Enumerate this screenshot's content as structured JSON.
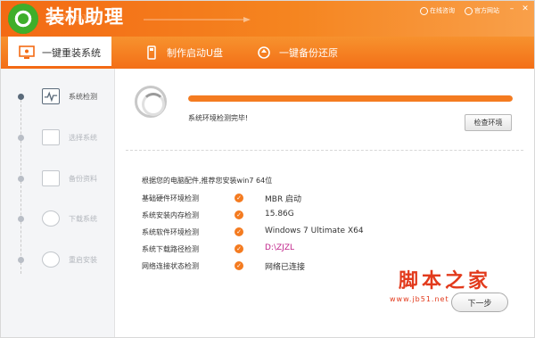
{
  "header": {
    "app_title": "装机助理",
    "online_help": "在线咨询",
    "forum": "官方网站"
  },
  "nav": {
    "tabs": [
      {
        "label": "一键重装系统",
        "icon": "monitor-icon",
        "active": true
      },
      {
        "label": "制作启动U盘",
        "icon": "usb-icon",
        "active": false
      },
      {
        "label": "一键备份还原",
        "icon": "backup-icon",
        "active": false
      }
    ]
  },
  "sidebar": {
    "steps": [
      {
        "label": "系统检测",
        "icon": "pulse-icon",
        "active": true
      },
      {
        "label": "选择系统",
        "icon": "monitor-icon",
        "active": false
      },
      {
        "label": "备份资料",
        "icon": "files-icon",
        "active": false
      },
      {
        "label": "下载系统",
        "icon": "download-icon",
        "active": false
      },
      {
        "label": "重启安装",
        "icon": "restart-icon",
        "active": false
      }
    ]
  },
  "detect": {
    "progress_percent": 100,
    "status": "系统环境检测完毕!",
    "check_button": "检查环境"
  },
  "recommend": "根据您的电脑配件,推荐您安装win7 64位",
  "checks": [
    {
      "label": "基础硬件环境检测",
      "value": "MBR 启动",
      "accent": false
    },
    {
      "label": "系统安装内存检测",
      "value": "15.86G",
      "accent": false
    },
    {
      "label": "系统软件环境检测",
      "value": "Windows 7 Ultimate X64",
      "accent": false
    },
    {
      "label": "系统下载路径检测",
      "value": "D:\\ZJZL",
      "accent": true
    },
    {
      "label": "网络连接状态检测",
      "value": "网络已连接",
      "accent": false
    }
  ],
  "next_button": "下一步",
  "watermark": {
    "main": "脚本之家",
    "sub": "www.jb51.net"
  },
  "colors": {
    "accent": "#f47b20",
    "header_start": "#f36a14",
    "value_accent": "#c0238a",
    "watermark": "#e23a1c"
  }
}
